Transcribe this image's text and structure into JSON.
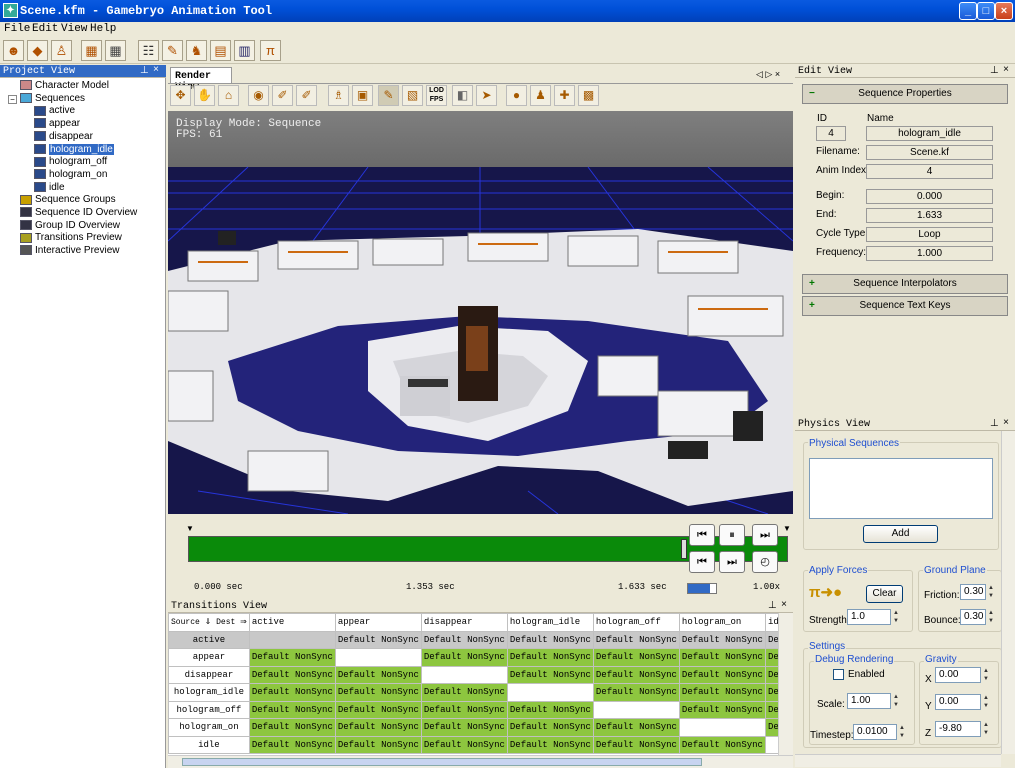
{
  "window": {
    "title": "Scene.kfm - Gamebryo Animation Tool",
    "minimize": "_",
    "maximize": "□",
    "close": "×"
  },
  "menu": [
    "File",
    "Edit",
    "View",
    "Help"
  ],
  "project": {
    "title": "Project View",
    "items": [
      {
        "label": "Character Model",
        "icon": "character-model-icon"
      },
      {
        "label": "Sequences",
        "icon": "sequences-icon"
      },
      {
        "label": "active",
        "icon": "sequence-icon"
      },
      {
        "label": "appear",
        "icon": "sequence-icon"
      },
      {
        "label": "disappear",
        "icon": "sequence-icon"
      },
      {
        "label": "hologram_idle",
        "icon": "sequence-icon"
      },
      {
        "label": "hologram_off",
        "icon": "sequence-icon"
      },
      {
        "label": "hologram_on",
        "icon": "sequence-icon"
      },
      {
        "label": "idle",
        "icon": "sequence-icon"
      },
      {
        "label": "Sequence Groups",
        "icon": "sequence-groups-icon"
      },
      {
        "label": "Sequence ID Overview",
        "icon": "id-overview-icon"
      },
      {
        "label": "Group ID Overview",
        "icon": "id-overview-icon"
      },
      {
        "label": "Transitions Preview",
        "icon": "transitions-preview-icon"
      },
      {
        "label": "Interactive Preview",
        "icon": "interactive-preview-icon"
      }
    ],
    "selected": "hologram_idle"
  },
  "render": {
    "tab": "Render View",
    "display_mode": "Display Mode: Sequence",
    "fps": "FPS: 61",
    "lod_label": "LOD\nFPS",
    "time_start": "0.000 sec",
    "time_current": "1.353 sec",
    "time_end": "1.633 sec",
    "speed": "1.00x",
    "progress_fraction": 0.828
  },
  "transitions": {
    "title": "Transitions View",
    "source_label": "Source",
    "dest_label": "Dest",
    "columns": [
      "active",
      "appear",
      "disappear",
      "hologram_idle",
      "hologram_off",
      "hologram_on",
      "idle"
    ],
    "rows": [
      "active",
      "appear",
      "disappear",
      "hologram_idle",
      "hologram_off",
      "hologram_on",
      "idle"
    ],
    "cell_text": "Default NonSync",
    "cell_text_short": "Defau"
  },
  "edit": {
    "title": "Edit View",
    "section": "Sequence Properties",
    "id_label": "ID",
    "name_label": "Name",
    "id": "4",
    "name": "hologram_idle",
    "filename_label": "Filename:",
    "filename": "Scene.kf",
    "anim_index_label": "Anim Index:",
    "anim_index": "4",
    "begin_label": "Begin:",
    "begin": "0.000",
    "end_label": "End:",
    "end": "1.633",
    "cycle_label": "Cycle Type:",
    "cycle": "Loop",
    "freq_label": "Frequency:",
    "freq": "1.000",
    "interp_section": "Sequence Interpolators",
    "textkeys_section": "Sequence Text Keys"
  },
  "physics": {
    "title": "Physics View",
    "physical_sequences": "Physical Sequences",
    "add": "Add",
    "apply_forces": "Apply Forces",
    "clear": "Clear",
    "strength_label": "Strength:",
    "strength": "1.0",
    "ground_plane": "Ground Plane",
    "friction_label": "Friction:",
    "friction": "0.30",
    "bounce_label": "Bounce:",
    "bounce": "0.30",
    "settings": "Settings",
    "debug_rendering": "Debug Rendering",
    "enabled_label": "Enabled",
    "scale_label": "Scale:",
    "scale": "1.00",
    "timestep_label": "Timestep:",
    "timestep": "0.0100",
    "gravity": "Gravity",
    "x_label": "X",
    "gx": "0.00",
    "y_label": "Y",
    "gy": "0.00",
    "z_label": "Z",
    "gz": "-9.80"
  }
}
